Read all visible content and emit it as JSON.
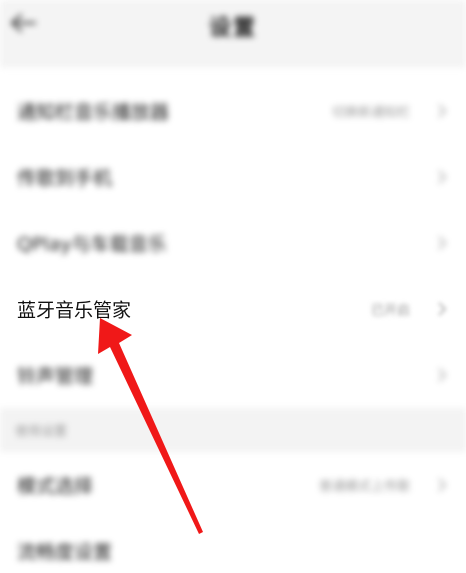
{
  "header": {
    "title": "设置",
    "back_icon": "arrow-left-icon"
  },
  "rows": [
    {
      "label": "通知栏音乐播放器",
      "value": "切换新通知栏"
    },
    {
      "label": "传歌到手机",
      "value": ""
    },
    {
      "label": "QPlay与车载音乐",
      "value": ""
    },
    {
      "label": "蓝牙音乐管家",
      "value": "已开启"
    },
    {
      "label": "铃声管理",
      "value": ""
    }
  ],
  "section": {
    "label": "使用设置"
  },
  "rows2": [
    {
      "label": "模式选择",
      "value": "普通模式上传歌"
    },
    {
      "label": "流畅度设置",
      "value": ""
    }
  ],
  "colors": {
    "annotation_arrow": "#f01818",
    "background": "#ffffff",
    "section_bg": "#f3f3f3"
  }
}
